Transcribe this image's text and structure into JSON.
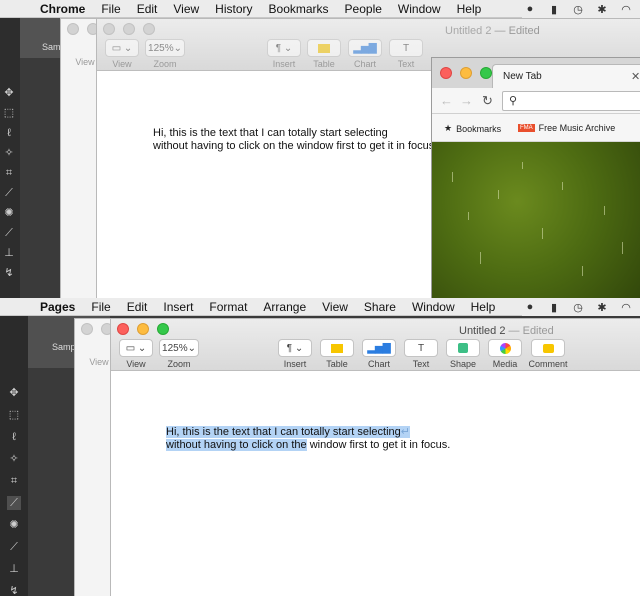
{
  "top": {
    "menubar": {
      "app": "Chrome",
      "items": [
        "File",
        "Edit",
        "View",
        "History",
        "Bookmarks",
        "People",
        "Window",
        "Help"
      ]
    },
    "ps": {
      "samp": "Samp"
    },
    "pages_back": {
      "view_label": "View"
    },
    "pages": {
      "title": "Untitled 2",
      "edited": "— Edited",
      "zoom_value": "125%",
      "toolbar_labels": {
        "view": "View",
        "zoom": "Zoom",
        "insert": "Insert",
        "table": "Table",
        "chart": "Chart",
        "text": "Text"
      },
      "doc_lines": [
        "Hi, this is the text that I can totally start selecting",
        "without having to click on the window first to get it in focus."
      ]
    },
    "chrome": {
      "tab_title": "New Tab",
      "bookmarks": [
        "Bookmarks",
        "Free Music Archive"
      ],
      "bookmark_badge": "FMA"
    }
  },
  "bottom": {
    "menubar": {
      "app": "Pages",
      "items": [
        "File",
        "Edit",
        "Insert",
        "Format",
        "Arrange",
        "View",
        "Share",
        "Window",
        "Help"
      ]
    },
    "ps": {
      "samp": "Samp"
    },
    "pages_back": {
      "view_label": "View"
    },
    "pages": {
      "title": "Untitled 2",
      "edited": "— Edited",
      "zoom_value": "125%",
      "toolbar_labels": {
        "view": "View",
        "zoom": "Zoom",
        "insert": "Insert",
        "table": "Table",
        "chart": "Chart",
        "text": "Text",
        "shape": "Shape",
        "media": "Media",
        "comment": "Comment"
      },
      "doc_lines_selected": [
        "Hi, this is the text that I can totally start selecting",
        "without having to click on the"
      ],
      "doc_line2_rest": " window first to get it in focus."
    }
  },
  "colors": {
    "selection": "#b3d3f5",
    "close": "#fc605c",
    "minimize": "#fdbc40",
    "zoom": "#34c84a"
  }
}
